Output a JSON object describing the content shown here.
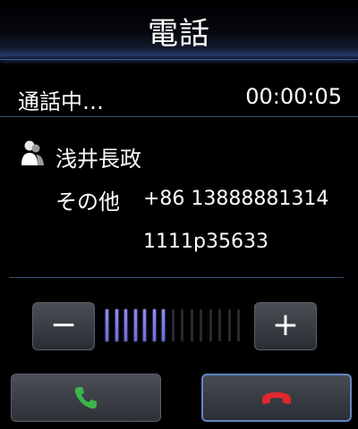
{
  "header": {
    "title": "電話"
  },
  "call": {
    "status": "通話中…",
    "duration": "00:00:05"
  },
  "contact": {
    "name": "浅井長政",
    "number_label": "その他",
    "number": "+86 13888881314",
    "extension": "1111p35633",
    "icon": "contact-person-icon"
  },
  "volume": {
    "minus_label": "−",
    "plus_label": "+",
    "level": 7,
    "max": 15,
    "active_color": "#8f8ff0",
    "inactive_color": "#2a2a2e"
  },
  "actions": {
    "answer_icon": "phone-answer-icon",
    "answer_color": "#3cb54a",
    "hangup_icon": "phone-hangup-icon",
    "hangup_color": "#e0282c"
  }
}
